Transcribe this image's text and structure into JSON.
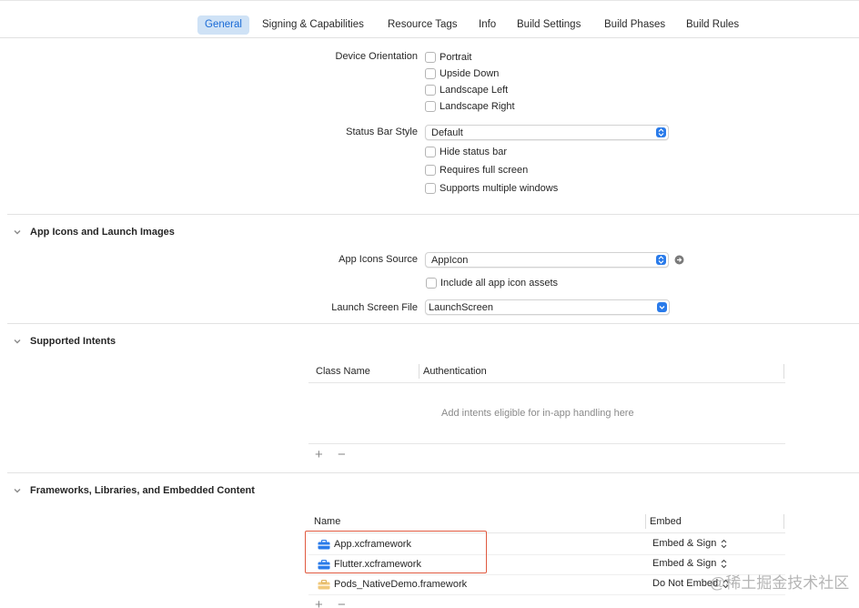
{
  "tabs": [
    {
      "label": "General",
      "active": true
    },
    {
      "label": "Signing & Capabilities"
    },
    {
      "label": "Resource Tags"
    },
    {
      "label": "Info"
    },
    {
      "label": "Build Settings"
    },
    {
      "label": "Build Phases"
    },
    {
      "label": "Build Rules"
    }
  ],
  "deployment": {
    "device_orientation_label": "Device Orientation",
    "orientations": [
      "Portrait",
      "Upside Down",
      "Landscape Left",
      "Landscape Right"
    ],
    "status_bar_style_label": "Status Bar Style",
    "status_bar_style_value": "Default",
    "status_options": [
      "Hide status bar",
      "Requires full screen",
      "Supports multiple windows"
    ]
  },
  "app_icons": {
    "section_title": "App Icons and Launch Images",
    "icons_source_label": "App Icons Source",
    "icons_source_value": "AppIcon",
    "include_all_label": "Include all app icon assets",
    "launch_screen_label": "Launch Screen File",
    "launch_screen_value": "LaunchScreen"
  },
  "intents": {
    "section_title": "Supported Intents",
    "col_class_name": "Class Name",
    "col_authentication": "Authentication",
    "placeholder": "Add intents eligible for in-app handling here",
    "add": "+",
    "remove": "−"
  },
  "frameworks": {
    "section_title": "Frameworks, Libraries, and Embedded Content",
    "col_name": "Name",
    "col_embed": "Embed",
    "rows": [
      {
        "name": "App.xcframework",
        "embed": "Embed & Sign"
      },
      {
        "name": "Flutter.xcframework",
        "embed": "Embed & Sign"
      },
      {
        "name": "Pods_NativeDemo.framework",
        "embed": "Do Not Embed"
      }
    ],
    "add": "+",
    "remove": "−"
  },
  "watermark": "@稀土掘金技术社区",
  "colors": {
    "accent": "#2a7bea",
    "highlight": "#e05a40",
    "tab_active_bg": "#cfe2f6"
  }
}
